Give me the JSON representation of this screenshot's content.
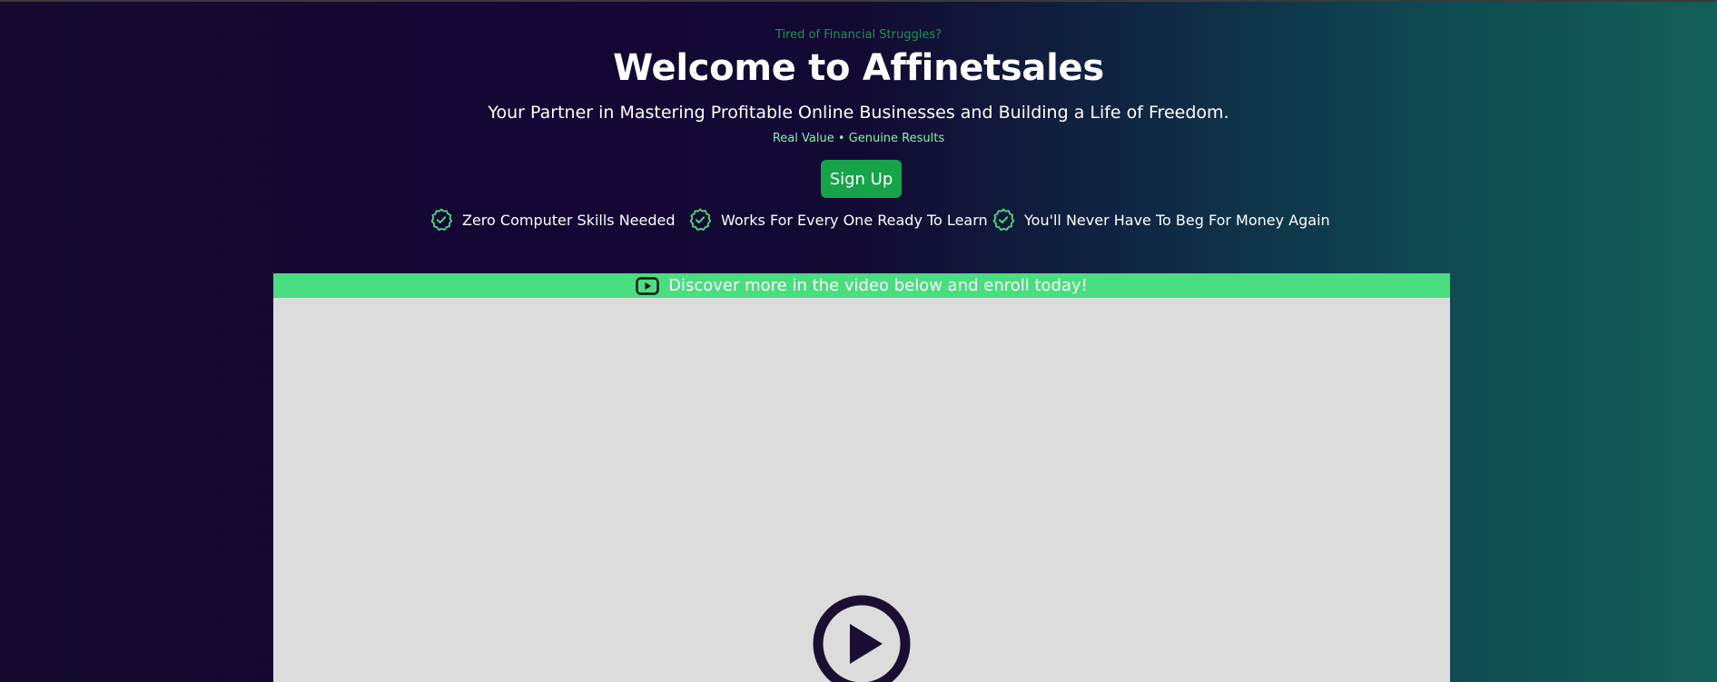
{
  "hero": {
    "eyebrow": "Tired of Financial Struggles?",
    "title": "Welcome to Affinetsales",
    "subtitle": "Your Partner in Mastering Profitable Online Businesses and Building a Life of Freedom.",
    "tagline": "Real Value • Genuine Results",
    "signup_label": "Sign Up"
  },
  "features": [
    {
      "label": "Zero Computer Skills Needed",
      "icon": "check-badge-icon"
    },
    {
      "label": "Works For Every One Ready To Learn",
      "icon": "check-badge-icon"
    },
    {
      "label": "You'll Never Have To Beg For Money Again",
      "icon": "check-badge-icon"
    }
  ],
  "video": {
    "banner_text": "Discover more in the video below and enroll today!",
    "banner_icon": "youtube-icon",
    "play_icon": "play-icon"
  },
  "colors": {
    "accent_green": "#16a34a",
    "banner_green": "#4ade80",
    "light_green": "#86efac",
    "play_dark": "#1a0f33"
  }
}
